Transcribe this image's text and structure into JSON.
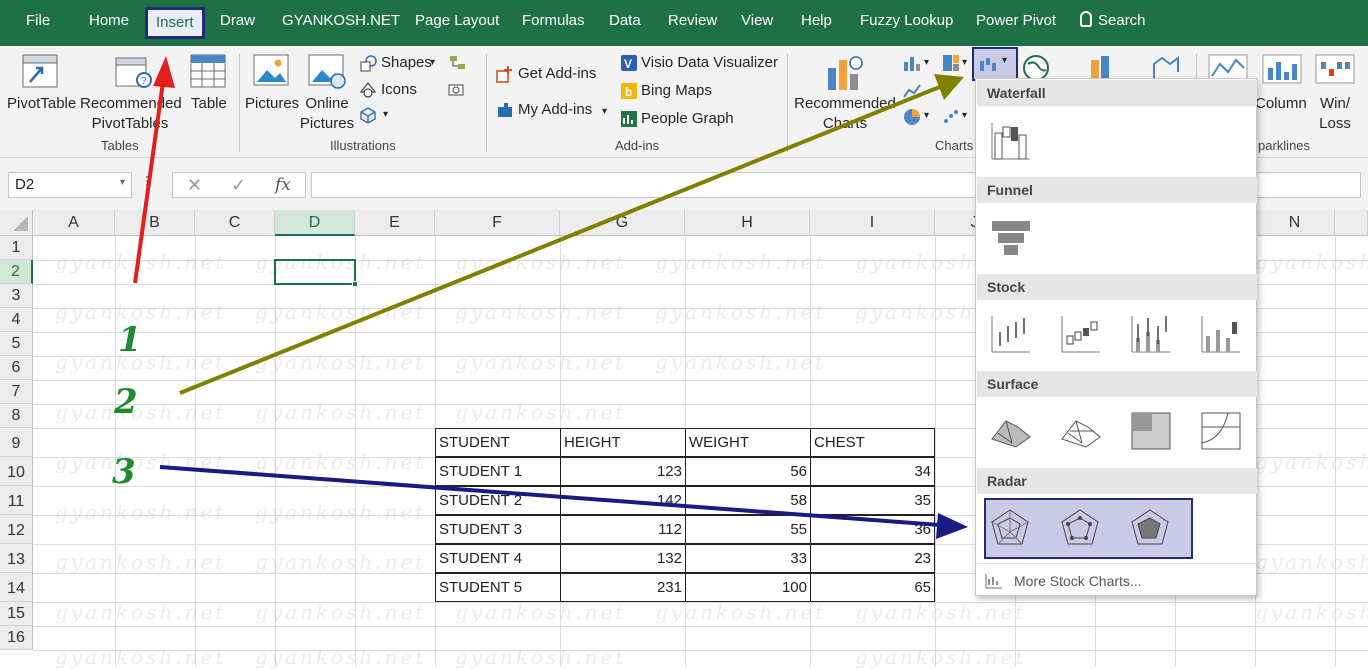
{
  "menu": {
    "items": [
      "File",
      "Home",
      "Insert",
      "Draw",
      "GYANKOSH.NET",
      "Page Layout",
      "Formulas",
      "Data",
      "Review",
      "View",
      "Help",
      "Fuzzy Lookup",
      "Power Pivot",
      "Search"
    ],
    "active": "Insert"
  },
  "ribbon": {
    "tables": {
      "pivottable": "PivotTable",
      "recommended_line1": "Recommended",
      "recommended_line2": "PivotTables",
      "table": "Table",
      "group": "Tables"
    },
    "illustrations": {
      "pictures": "Pictures",
      "online_line1": "Online",
      "online_line2": "Pictures",
      "shapes": "Shapes",
      "icons": "Icons",
      "group": "Illustrations"
    },
    "addins": {
      "get": "Get Add-ins",
      "my": "My Add-ins",
      "visio": "Visio Data Visualizer",
      "bing": "Bing Maps",
      "people": "People Graph",
      "group": "Add-ins"
    },
    "charts": {
      "recommended_line1": "Recommended",
      "recommended_line2": "Charts",
      "group": "Charts"
    },
    "sparklines": {
      "column": "Column",
      "winloss_line1": "Win/",
      "winloss_line2": "Loss",
      "group": "parklines"
    }
  },
  "formula_bar": {
    "name_box": "D2",
    "fx": "fx",
    "value": ""
  },
  "grid": {
    "columns": [
      "A",
      "B",
      "C",
      "D",
      "E",
      "F",
      "G",
      "H",
      "I",
      "J",
      "N"
    ],
    "rows": [
      "1",
      "2",
      "3",
      "4",
      "5",
      "6",
      "7",
      "8",
      "9",
      "10",
      "11",
      "12",
      "13",
      "14",
      "15",
      "16"
    ],
    "selected_cell": "D2",
    "watermark": "gyankosh.net"
  },
  "table": {
    "headers": [
      "STUDENT",
      "HEIGHT",
      "WEIGHT",
      "CHEST"
    ],
    "rows": [
      [
        "STUDENT 1",
        "123",
        "56",
        "34"
      ],
      [
        "STUDENT 2",
        "142",
        "58",
        "35"
      ],
      [
        "STUDENT 3",
        "112",
        "55",
        "36"
      ],
      [
        "STUDENT 4",
        "132",
        "33",
        "23"
      ],
      [
        "STUDENT 5",
        "231",
        "100",
        "65"
      ]
    ]
  },
  "annotations": {
    "step1": "1",
    "step2": "2",
    "step3": "3",
    "arrow_red": "#e31e1e",
    "arrow_olive": "#808000",
    "arrow_navy": "#1a1a80"
  },
  "dropdown": {
    "sections": [
      "Waterfall",
      "Funnel",
      "Stock",
      "Surface",
      "Radar"
    ],
    "more_link": "More Stock Charts..."
  },
  "colors": {
    "excel_green": "#1e7145",
    "highlight_border": "#232a7a"
  }
}
